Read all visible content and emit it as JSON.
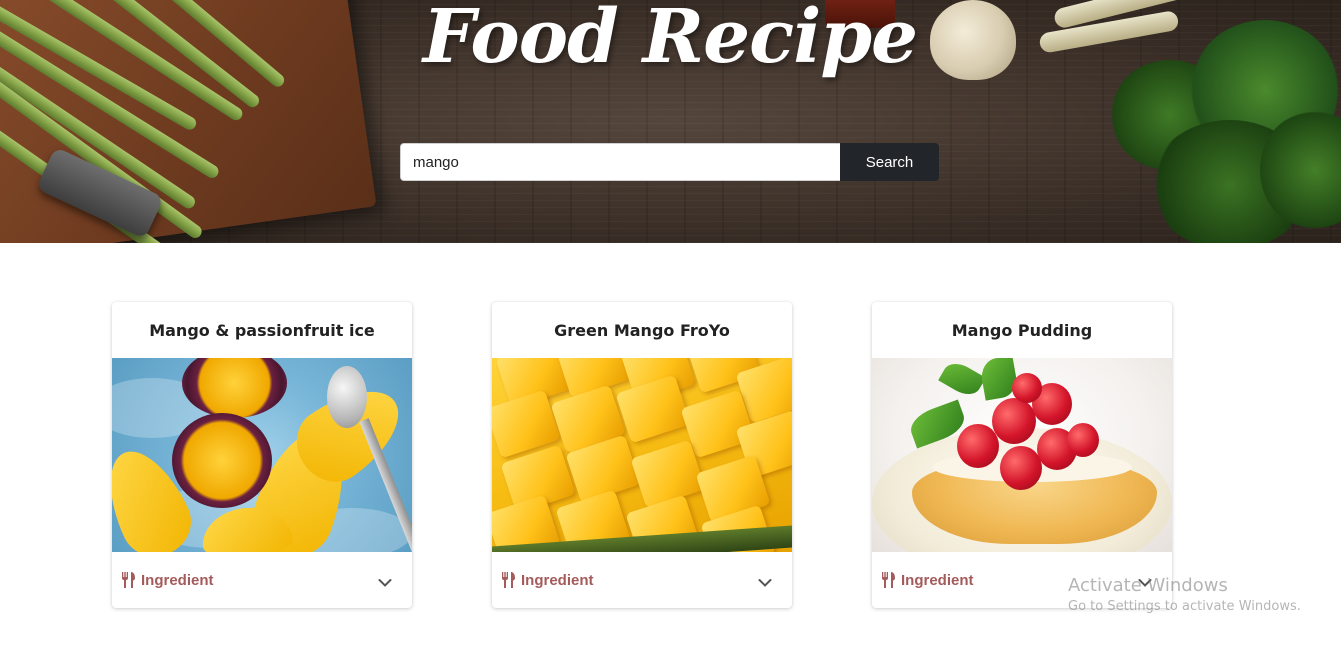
{
  "header": {
    "title": "Food Recipe"
  },
  "search": {
    "value": "mango",
    "button_label": "Search"
  },
  "cards": [
    {
      "title": "Mango & passionfruit ice",
      "image": "mango-passionfruit-ice-photo",
      "ingredient_label": "Ingredient"
    },
    {
      "title": "Green Mango FroYo",
      "image": "mango-cubes-photo",
      "ingredient_label": "Ingredient"
    },
    {
      "title": "Mango Pudding",
      "image": "mango-pudding-photo",
      "ingredient_label": "Ingredient"
    }
  ],
  "icons": {
    "ingredient": "fork-knife-icon",
    "expand": "chevron-down-icon"
  },
  "colors": {
    "accent": "#a45b5b",
    "search_button": "#22262b"
  },
  "watermark": {
    "title": "Activate Windows",
    "subtitle": "Go to Settings to activate Windows."
  }
}
